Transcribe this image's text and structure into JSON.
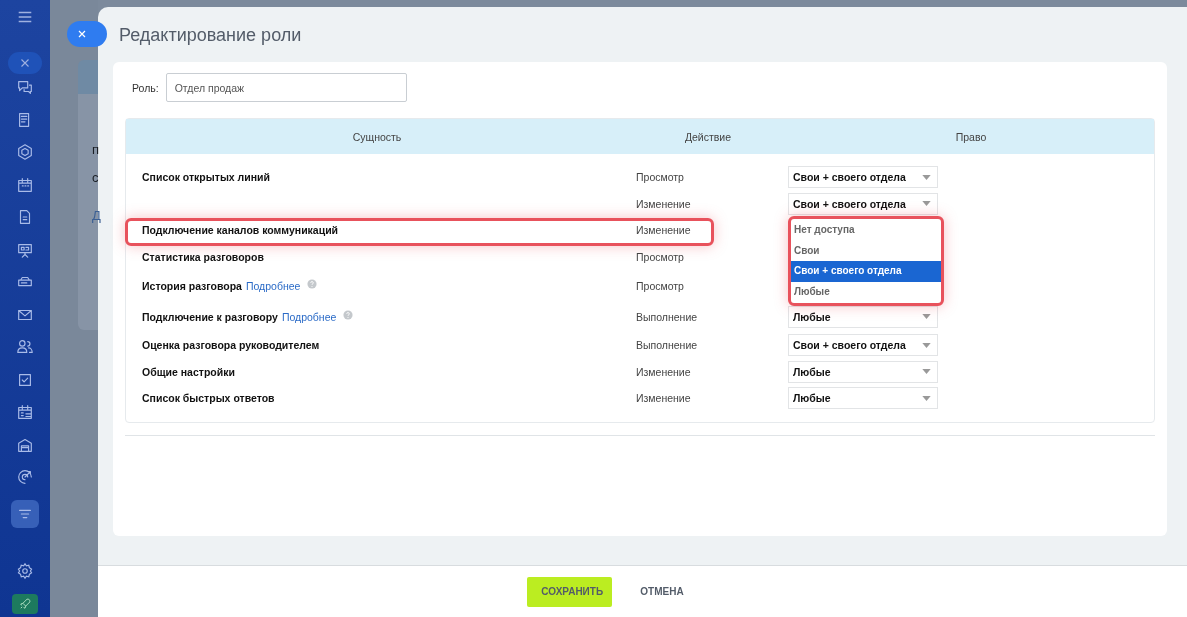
{
  "sidebar": {
    "items": [
      {
        "active": false
      },
      {
        "active": false
      },
      {
        "active": false
      },
      {
        "active": false
      },
      {
        "active": false
      },
      {
        "active": false
      },
      {
        "active": false
      },
      {
        "active": false
      },
      {
        "active": false
      },
      {
        "active": false
      },
      {
        "active": false
      },
      {
        "active": false
      },
      {
        "active": false
      },
      {
        "active": true
      }
    ]
  },
  "background_page": {
    "texts": [
      "п",
      "с",
      "Д"
    ]
  },
  "panel": {
    "title": "Редактирование роли"
  },
  "role": {
    "label": "Роль:",
    "value": "Отдел продаж"
  },
  "table": {
    "columns": [
      "Сущность",
      "Действие",
      "Право"
    ],
    "rows": [
      {
        "entity": "Список открытых линий",
        "action": "Просмотр",
        "right": "Свои + своего отдела"
      },
      {
        "action": "Изменение",
        "right": "Свои + своего отдела"
      },
      {
        "entity": "Подключение каналов коммуникаций",
        "action": "Изменение",
        "highlighted": true,
        "dropdown": {
          "options": [
            {
              "label": "Нет доступа",
              "selected": false
            },
            {
              "label": "Свои",
              "selected": false
            },
            {
              "label": "Свои + своего отдела",
              "selected": true
            },
            {
              "label": "Любые",
              "selected": false
            }
          ]
        }
      },
      {
        "entity": "Статистика разговоров",
        "action": "Просмотр"
      },
      {
        "entity": "История разговора",
        "link": "Подробнее",
        "help": true,
        "action": "Просмотр"
      },
      {
        "entity": "Подключение к разговору",
        "link": "Подробнее",
        "help": true,
        "action": "Выполнение",
        "right": "Любые"
      },
      {
        "entity": "Оценка разговора руководителем",
        "action": "Выполнение",
        "right": "Свои + своего отдела"
      },
      {
        "entity": "Общие настройки",
        "action": "Изменение",
        "right": "Любые"
      },
      {
        "entity": "Список быстрых ответов",
        "action": "Изменение",
        "right": "Любые"
      }
    ]
  },
  "footer": {
    "buttons": [
      {
        "label": "СОХРАНИТЬ",
        "kind": "primary"
      },
      {
        "label": "ОТМЕНА",
        "kind": "link"
      }
    ]
  }
}
